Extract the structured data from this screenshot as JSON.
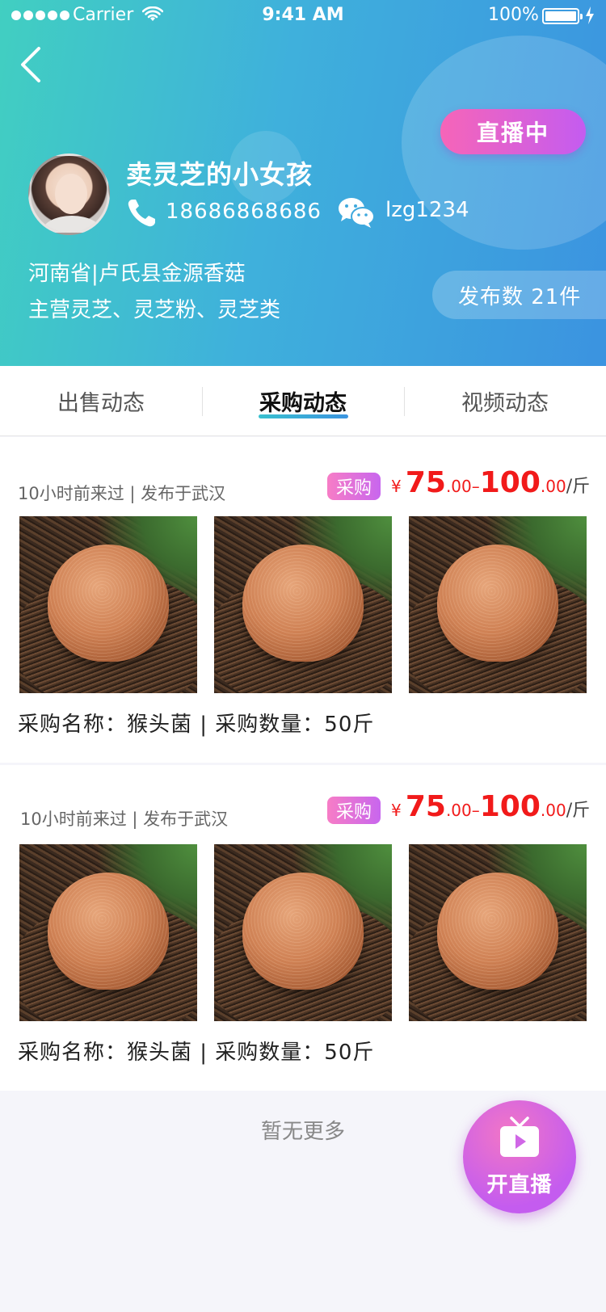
{
  "status_bar": {
    "carrier": "Carrier",
    "time": "9:41 AM",
    "battery": "100%"
  },
  "header": {
    "back_icon": "chevron-left-icon",
    "live_badge": "直播中",
    "shop_name": "卖灵芝的小女孩",
    "phone": "18686868686",
    "wechat": "lzg1234",
    "address": "河南省|卢氏县金源香菇",
    "business": "主营灵芝、灵芝粉、灵芝类",
    "publish_count": "发布数 21件"
  },
  "tabs": [
    {
      "label": "出售动态",
      "active": false
    },
    {
      "label": "采购动态",
      "active": true
    },
    {
      "label": "视频动态",
      "active": false
    }
  ],
  "posts": [
    {
      "meta": "10小时前来过 | 发布于武汉",
      "tag": "采购",
      "price_currency": "¥",
      "price_low_int": "75",
      "price_low_dec": ".00",
      "price_sep": "–",
      "price_high_int": "100",
      "price_high_dec": ".00",
      "price_unit": "/斤",
      "description": "采购名称：猴头菌 | 采购数量：50斤"
    },
    {
      "meta": "10小时前来过 | 发布于武汉",
      "tag": "采购",
      "price_currency": "¥",
      "price_low_int": "75",
      "price_low_dec": ".00",
      "price_sep": "–",
      "price_high_int": "100",
      "price_high_dec": ".00",
      "price_unit": "/斤",
      "description": "采购名称：猴头菌 | 采购数量：50斤"
    }
  ],
  "footer": {
    "no_more": "暂无更多"
  },
  "live_fab": {
    "icon": "tv-play-icon",
    "label": "开直播"
  },
  "colors": {
    "header_gradient_start": "#41cfc1",
    "header_gradient_end": "#3b93e0",
    "accent_pink": "#f665b8",
    "accent_purple": "#c45cf0",
    "price_red": "#f11a1a"
  }
}
